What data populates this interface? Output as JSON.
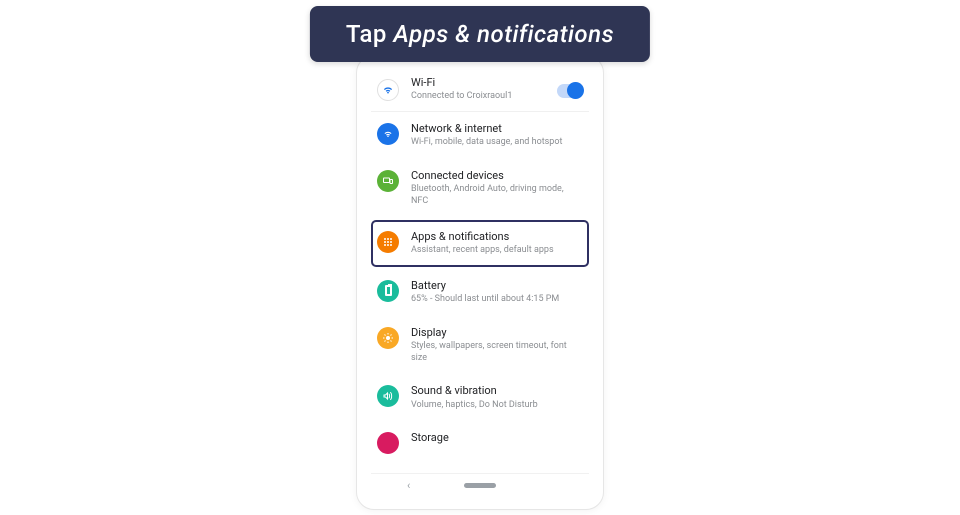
{
  "instruction": {
    "prefix": "Tap ",
    "target": "Apps & notifications"
  },
  "settings": {
    "wifi": {
      "title": "Wi-Fi",
      "subtitle": "Connected to Croixraoul1"
    },
    "network": {
      "title": "Network & internet",
      "subtitle": "Wi-Fi, mobile, data usage, and hotspot"
    },
    "devices": {
      "title": "Connected devices",
      "subtitle": "Bluetooth, Android Auto, driving mode, NFC"
    },
    "apps": {
      "title": "Apps & notifications",
      "subtitle": "Assistant, recent apps, default apps"
    },
    "battery": {
      "title": "Battery",
      "subtitle": "65% - Should last until about 4:15 PM"
    },
    "display": {
      "title": "Display",
      "subtitle": "Styles, wallpapers, screen timeout, font size"
    },
    "sound": {
      "title": "Sound & vibration",
      "subtitle": "Volume, haptics, Do Not Disturb"
    },
    "storage": {
      "title": "Storage"
    }
  }
}
